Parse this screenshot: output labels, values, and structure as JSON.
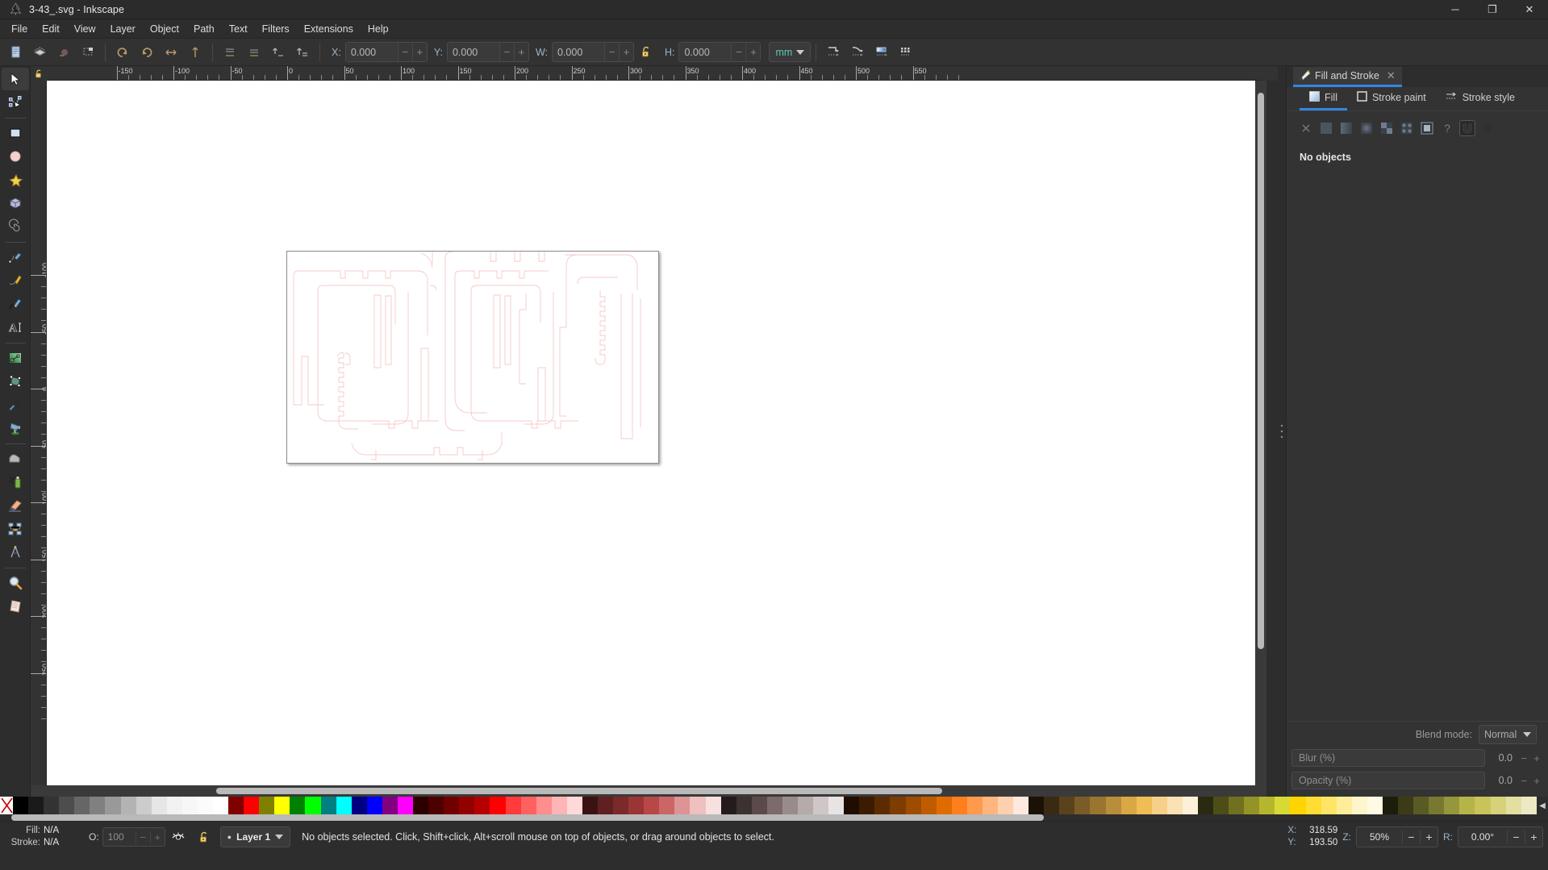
{
  "window": {
    "title": "3-43_.svg - Inkscape",
    "app_icon": "inkscape-logo-icon",
    "minimize": "─",
    "maximize": "❐",
    "close": "✕"
  },
  "menubar": {
    "items": [
      {
        "label": "File"
      },
      {
        "label": "Edit"
      },
      {
        "label": "View"
      },
      {
        "label": "Layer"
      },
      {
        "label": "Object"
      },
      {
        "label": "Path"
      },
      {
        "label": "Text"
      },
      {
        "label": "Filters"
      },
      {
        "label": "Extensions"
      },
      {
        "label": "Help"
      }
    ]
  },
  "toolbar": {
    "x": {
      "label": "X:",
      "value": "0.000"
    },
    "y": {
      "label": "Y:",
      "value": "0.000"
    },
    "w": {
      "label": "W:",
      "value": "0.000"
    },
    "h": {
      "label": "H:",
      "value": "0.000"
    },
    "lock_icon": "unlocked-padlock-icon",
    "units": "mm",
    "minus": "−",
    "plus": "+",
    "left_buttons": [
      {
        "name": "document-properties-icon"
      },
      {
        "name": "layers-icon"
      },
      {
        "name": "object-properties-icon"
      },
      {
        "name": "selection-icon"
      }
    ],
    "transform_buttons": [
      {
        "name": "rotate-ccw-icon"
      },
      {
        "name": "rotate-cw-icon"
      },
      {
        "name": "flip-horizontal-icon"
      },
      {
        "name": "flip-vertical-icon"
      }
    ],
    "raise_buttons": [
      {
        "name": "lower-to-bottom-icon"
      },
      {
        "name": "lower-icon"
      },
      {
        "name": "raise-icon"
      },
      {
        "name": "raise-to-top-icon"
      }
    ],
    "right_buttons": [
      {
        "name": "affect-stroke-width-icon"
      },
      {
        "name": "affect-rounded-corners-icon"
      },
      {
        "name": "affect-gradients-icon"
      },
      {
        "name": "affect-patterns-icon"
      }
    ]
  },
  "toolbox": {
    "tools": [
      {
        "name": "selector-tool",
        "icon": "arrow-cursor-icon",
        "active": true
      },
      {
        "name": "node-tool",
        "icon": "node-editor-icon",
        "active": false
      },
      {
        "name": "rectangle-tool",
        "icon": "rectangle-icon",
        "active": false
      },
      {
        "name": "ellipse-tool",
        "icon": "circle-icon",
        "active": false
      },
      {
        "name": "star-tool",
        "icon": "star-icon",
        "active": false
      },
      {
        "name": "box3d-tool",
        "icon": "cube-icon",
        "active": false
      },
      {
        "name": "spiral-tool",
        "icon": "spiral-icon",
        "active": false
      },
      {
        "name": "pencil-tool",
        "icon": "pencil-icon",
        "active": false
      },
      {
        "name": "bezier-tool",
        "icon": "bezier-pen-icon",
        "active": false
      },
      {
        "name": "calligraphy-tool",
        "icon": "calligraphy-pen-icon",
        "active": false
      },
      {
        "name": "text-tool",
        "icon": "text-a-icon",
        "active": false
      },
      {
        "name": "gradient-tool",
        "icon": "gradient-icon",
        "active": false
      },
      {
        "name": "mesh-tool",
        "icon": "mesh-gradient-icon",
        "active": false
      },
      {
        "name": "dropper-tool",
        "icon": "eyedropper-icon",
        "active": false
      },
      {
        "name": "paintbucket-tool",
        "icon": "paint-bucket-icon",
        "active": false
      },
      {
        "name": "tweak-tool",
        "icon": "tweak-icon",
        "active": false
      },
      {
        "name": "spray-tool",
        "icon": "spray-can-icon",
        "active": false
      },
      {
        "name": "eraser-tool",
        "icon": "eraser-icon",
        "active": false
      },
      {
        "name": "connector-tool",
        "icon": "connector-icon",
        "active": false
      },
      {
        "name": "measure-tool",
        "icon": "measure-compass-icon",
        "active": false
      },
      {
        "name": "zoom-tool",
        "icon": "magnifier-icon",
        "active": false
      },
      {
        "name": "pages-tool",
        "icon": "pages-icon",
        "active": false
      }
    ]
  },
  "rulers": {
    "horizontal_ticks": [
      "-150",
      "-100",
      "-50",
      "0",
      "50",
      "100",
      "150",
      "200",
      "250",
      "300",
      "350",
      "400",
      "450",
      "500",
      "550"
    ],
    "vertical_ticks": [
      "-100",
      "-50",
      "0",
      "50",
      "100",
      "150",
      "200",
      "250"
    ],
    "unit": "mm"
  },
  "canvas": {
    "page_label": "drawing-page",
    "stroke_color": "#f7c8c8",
    "background": "#ffffff"
  },
  "dock": {
    "tab": {
      "label": "Fill and Stroke",
      "icon": "fill-stroke-icon",
      "close": "✕"
    },
    "subtabs": [
      {
        "label": "Fill",
        "icon": "fill-swatch-icon",
        "active": true
      },
      {
        "label": "Stroke paint",
        "icon": "stroke-square-icon",
        "active": false
      },
      {
        "label": "Stroke style",
        "icon": "stroke-style-icon",
        "active": false
      }
    ],
    "paint_types": [
      {
        "name": "no-paint-button",
        "icon": "x-icon"
      },
      {
        "name": "flat-color-button",
        "icon": "flat-square-icon"
      },
      {
        "name": "linear-gradient-button",
        "icon": "linear-gradient-icon"
      },
      {
        "name": "radial-gradient-button",
        "icon": "radial-gradient-icon"
      },
      {
        "name": "pattern-button",
        "icon": "checker-icon"
      },
      {
        "name": "swatch-button",
        "icon": "swatch-icon"
      },
      {
        "name": "mesh-gradient-button",
        "icon": "mesh-icon"
      },
      {
        "name": "unknown-paint-button",
        "icon": "question-mark-icon"
      },
      {
        "name": "fill-rule-evenodd-button",
        "icon": "evenodd-icon"
      },
      {
        "name": "fill-rule-nonzero-button",
        "icon": "nonzero-icon"
      }
    ],
    "empty_message": "No objects",
    "blend": {
      "label": "Blend mode:",
      "value": "Normal"
    },
    "blur": {
      "label": "Blur (%)",
      "value": "0.0"
    },
    "opacity": {
      "label": "Opacity (%)",
      "value": "0.0"
    },
    "minus": "−",
    "plus": "+"
  },
  "palette": {
    "none_label": "X",
    "arrow": "◀",
    "colors": [
      "#000000",
      "#1a1a1a",
      "#333333",
      "#4d4d4d",
      "#666666",
      "#808080",
      "#999999",
      "#b3b3b3",
      "#cccccc",
      "#e6e6e6",
      "#f2f2f2",
      "#f7f7f7",
      "#fbfbfb",
      "#ffffff",
      "#800000",
      "#ff0000",
      "#808000",
      "#ffff00",
      "#008000",
      "#00ff00",
      "#008080",
      "#00ffff",
      "#000080",
      "#0000ff",
      "#800080",
      "#ff00ff",
      "#2b0000",
      "#4d0000",
      "#700000",
      "#930000",
      "#b60000",
      "#ff0000",
      "#ff3b3b",
      "#ff6161",
      "#ff8d8d",
      "#ffb5b5",
      "#ffd9d9",
      "#3a1212",
      "#5e2020",
      "#7a2a2a",
      "#9b3535",
      "#b84747",
      "#cc6666",
      "#dd9494",
      "#eec0c0",
      "#f7e0e0",
      "#241c1c",
      "#3d3232",
      "#5c4a4a",
      "#7d6a6a",
      "#9a8b8b",
      "#b6aaaa",
      "#cfc6c6",
      "#e8e4e4",
      "#1f0e00",
      "#3b1c00",
      "#5c2c00",
      "#7d3c00",
      "#9e4c00",
      "#c05c00",
      "#e06c00",
      "#ff7f1e",
      "#ff9a4d",
      "#ffb57d",
      "#ffd0ad",
      "#ffe8dd",
      "#1b1207",
      "#3a2a12",
      "#5a431c",
      "#7a5c26",
      "#9a7530",
      "#b98e3a",
      "#d9a744",
      "#f0bd55",
      "#f6d088",
      "#fae2b4",
      "#fdf0d8",
      "#2a2a10",
      "#4d4d17",
      "#70701f",
      "#939326",
      "#b6b62e",
      "#d9d935",
      "#ffd400",
      "#ffdd33",
      "#ffe566",
      "#ffee99",
      "#fff5cc",
      "#fffae6",
      "#1d1d0c",
      "#3b3b18",
      "#5a5a24",
      "#787830",
      "#96963c",
      "#b4b448",
      "#c8c45a",
      "#d6d279",
      "#e2dfa0",
      "#ece9c4"
    ]
  },
  "statusbar": {
    "fill": {
      "label": "Fill:",
      "value": "N/A"
    },
    "stroke": {
      "label": "Stroke:",
      "value": "N/A"
    },
    "opacity": {
      "label": "O:",
      "value": "100"
    },
    "visibility_icon": "eye-icon",
    "lock_icon": "unlocked-padlock-icon",
    "layer": "Layer 1",
    "message": "No objects selected. Click, Shift+click, Alt+scroll mouse on top of objects, or drag around objects to select.",
    "x": {
      "label": "X:",
      "value": "318.59"
    },
    "y": {
      "label": "Y:",
      "value": "193.50"
    },
    "zoom": {
      "label": "Z:",
      "value": "50%"
    },
    "rotation": {
      "label": "R:",
      "value": "0.00°"
    },
    "minus": "−",
    "plus": "+"
  }
}
